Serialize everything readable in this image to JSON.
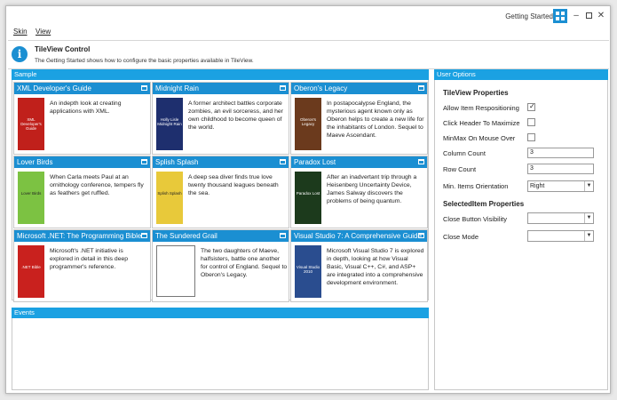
{
  "window": {
    "title": "Getting Started",
    "app_icon": "tiles-icon"
  },
  "menu": {
    "items": [
      "Skin",
      "View"
    ]
  },
  "info": {
    "title": "TileView Control",
    "description": "The Getting Started shows how to configure the basic properties available in TileView.",
    "icon": "info-icon"
  },
  "sample": {
    "header": "Sample"
  },
  "events": {
    "header": "Events"
  },
  "tiles": [
    {
      "title": "XML Developer's Guide",
      "description": "An indepth look at creating applications with XML.",
      "cover_text": "XML Developer's Guide",
      "cover_color": "#c0201b"
    },
    {
      "title": "Midnight Rain",
      "description": "A former architect battles corporate zombies, an evil sorceress, and her own childhood to become queen of the world.",
      "cover_text": "Holly Lisle Midnight Rain",
      "cover_color": "#1e2f6e"
    },
    {
      "title": "Oberon's Legacy",
      "description": "In postapocalypse England, the mysterious agent known only as Oberon helps to create a new life for the inhabitants of London. Sequel to Maeve Ascendant.",
      "cover_text": "Oberon's Legacy",
      "cover_color": "#6b3a1d"
    },
    {
      "title": "Lover Birds",
      "description": "When Carla meets Paul at an ornithology conference, tempers fly as feathers get ruffled.",
      "cover_text": "Lover Birds",
      "cover_color": "#7cc242"
    },
    {
      "title": "Splish Splash",
      "description": "A deep sea diver finds true love twenty thousand leagues beneath the sea.",
      "cover_text": "Splish Splash",
      "cover_color": "#e8c93a"
    },
    {
      "title": "Paradox Lost",
      "description": "After an inadvertant trip through a Heisenberg Uncertainty Device, James Salway discovers the problems of being quantum.",
      "cover_text": "Paradox Lost",
      "cover_color": "#1c3a1c"
    },
    {
      "title": "Microsoft .NET: The Programming Bible",
      "description": "Microsoft's .NET initiative is explored in detail in this deep programmer's reference.",
      "cover_text": ".NET Bible",
      "cover_color": "#c9211e"
    },
    {
      "title": "The Sundered Grail",
      "description": "The two daughters of Maeve, halfsisters, battle one another for control of England. Sequel to Oberon's Legacy.",
      "cover_text": "",
      "cover_color": "#ffffff"
    },
    {
      "title": "Visual Studio 7: A Comprehensive Guide",
      "description": "Microsoft Visual Studio 7 is explored in depth, looking at how Visual Basic, Visual C++, C#, and ASP+ are integrated into a comprehensive development environment.",
      "cover_text": "Visual Studio 2010",
      "cover_color": "#2a4d8f"
    }
  ],
  "options": {
    "header": "User Options",
    "tileview_heading": "TileView Properties",
    "allow_reposition": {
      "label": "Allow Item Respositioning",
      "checked": true
    },
    "click_header": {
      "label": "Click Header To Maximize",
      "checked": false
    },
    "minmax_hover": {
      "label": "MinMax On Mouse Over",
      "checked": false
    },
    "column_count": {
      "label": "Column Count",
      "value": "3"
    },
    "row_count": {
      "label": "Row Count",
      "value": "3"
    },
    "min_orientation": {
      "label": "Min. Items Orientation",
      "value": "Right"
    },
    "selected_heading": "SelectedItem Properties",
    "close_visibility": {
      "label": "Close Button Visibility",
      "value": ""
    },
    "close_mode": {
      "label": "Close Mode",
      "value": ""
    }
  },
  "colors": {
    "accent": "#1ba1e2",
    "tile_header": "#1b8fd2"
  }
}
